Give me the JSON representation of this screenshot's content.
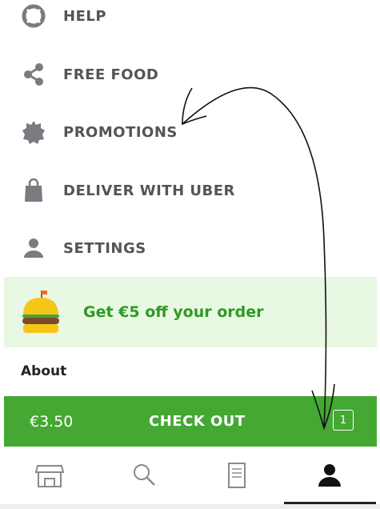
{
  "menu": {
    "items": [
      {
        "label": "HELP",
        "icon": "lifebuoy-icon"
      },
      {
        "label": "FREE FOOD",
        "icon": "share-icon"
      },
      {
        "label": "PROMOTIONS",
        "icon": "badge-icon"
      },
      {
        "label": "DELIVER WITH UBER",
        "icon": "bag-icon"
      },
      {
        "label": "SETTINGS",
        "icon": "person-icon"
      }
    ]
  },
  "promo": {
    "text": "Get €5 off your order",
    "icon": "burger-icon"
  },
  "about": {
    "label": "About"
  },
  "checkout": {
    "price": "€3.50",
    "label": "CHECK OUT",
    "item_count": "1"
  },
  "tabbar": {
    "tabs": [
      {
        "icon": "store-icon"
      },
      {
        "icon": "search-icon"
      },
      {
        "icon": "receipt-icon"
      },
      {
        "icon": "account-icon",
        "selected": true
      }
    ]
  },
  "colors": {
    "menu_text": "#545454",
    "icon_gray": "#7a7a80",
    "promo_bg": "#e8f8e2",
    "promo_text": "#2e9a22",
    "checkout_green": "#44a833"
  }
}
